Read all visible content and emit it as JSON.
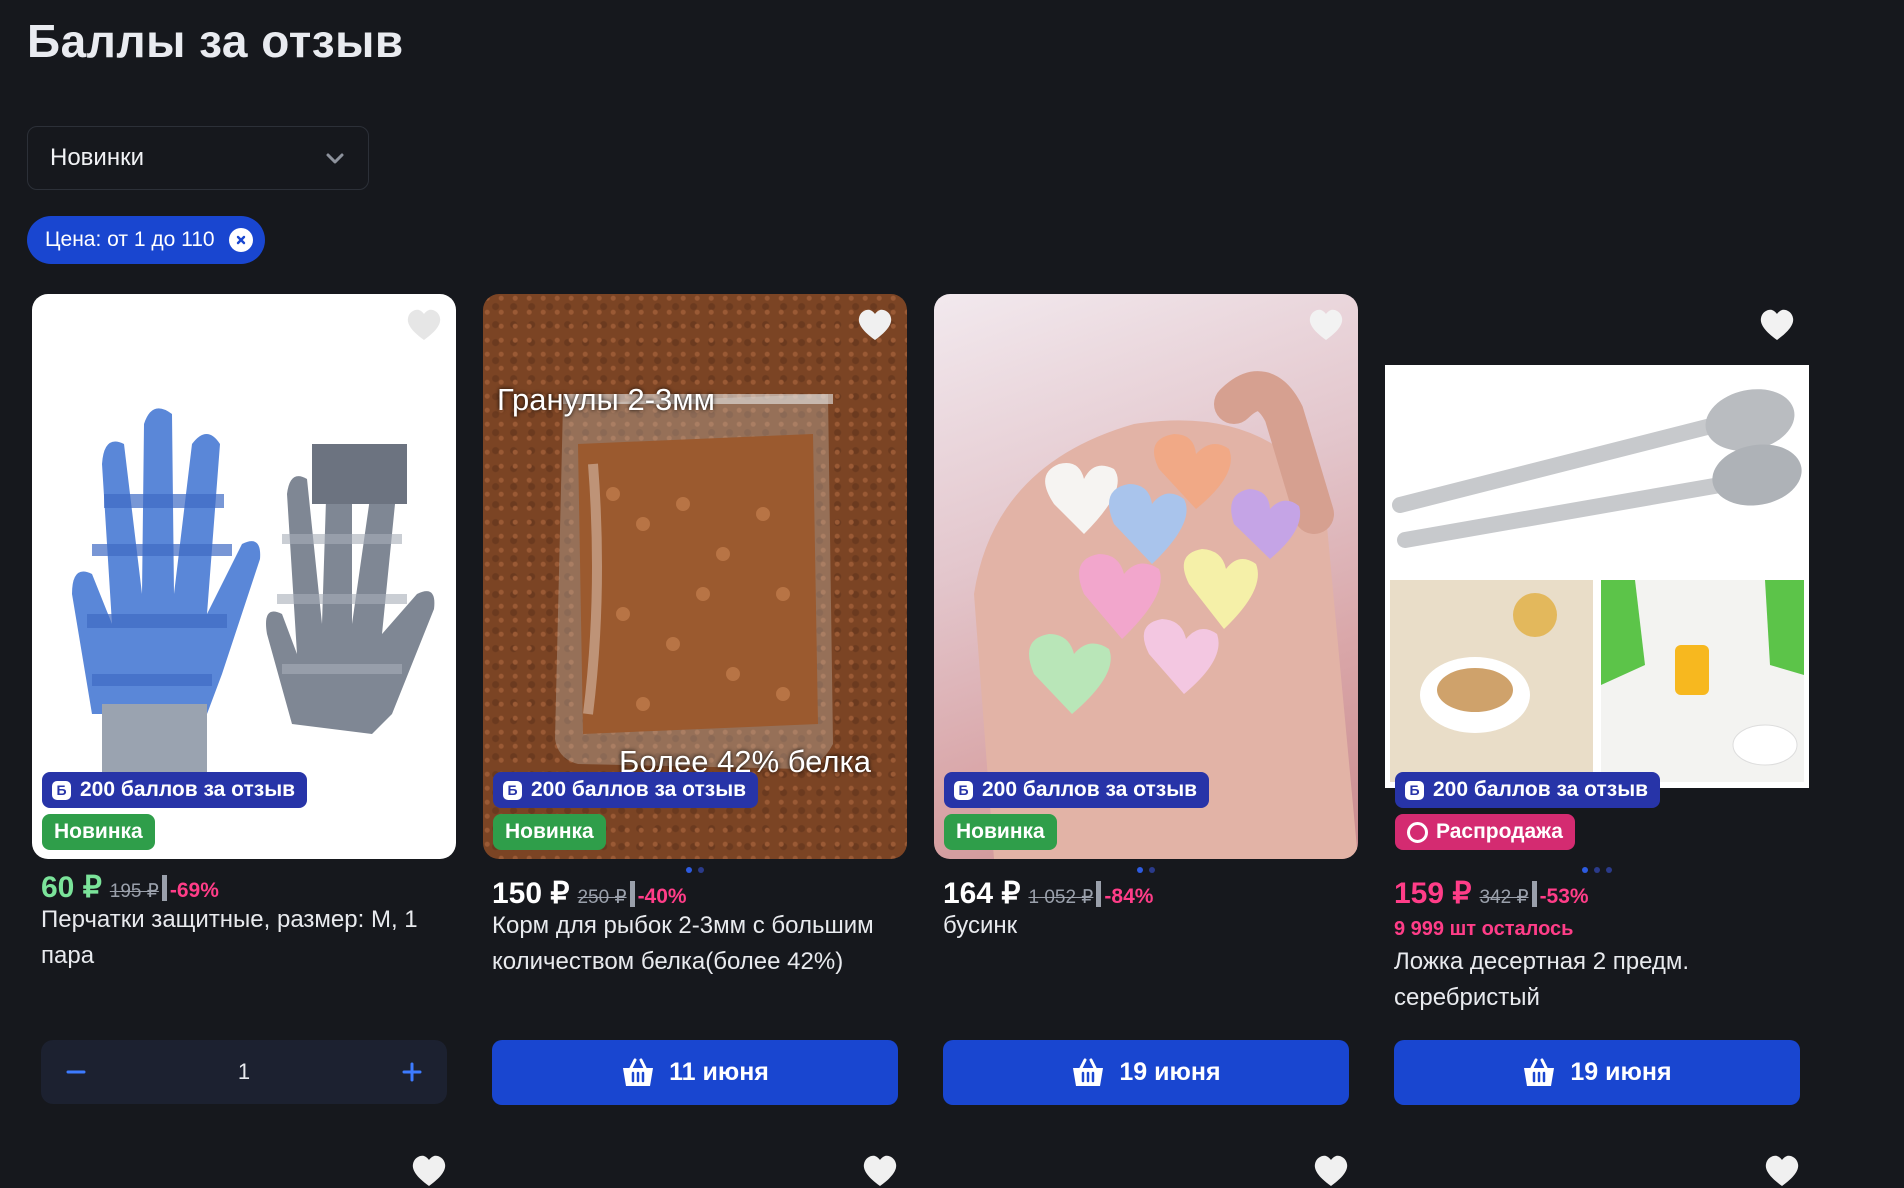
{
  "page": {
    "title": "Баллы за отзыв"
  },
  "sort": {
    "selected": "Новинки"
  },
  "filter_chip": {
    "label": "Цена: от 1 до 110"
  },
  "points_badge_label": "200 баллов за отзыв",
  "points_badge_letter": "Б",
  "colors": {
    "accent": "#1946d0",
    "background": "#16181d",
    "new_badge": "#2f9e4a",
    "sale_badge": "#d42b71",
    "discount": "#ff3d88",
    "price_green": "#7be39a"
  },
  "products": [
    {
      "tag": "Новинка",
      "price": "60 ₽",
      "old_price": "195 ₽",
      "discount": "-69%",
      "name": "Перчатки защитные, размер: M, 1 пара",
      "quantity": "1",
      "image_caption_top": "",
      "image_caption_bottom": ""
    },
    {
      "tag": "Новинка",
      "price": "150 ₽",
      "old_price": "250 ₽",
      "discount": "-40%",
      "name": "Корм для рыбок 2-3мм с большим количеством белка(более 42%)",
      "delivery": "11 июня",
      "image_caption_top": "Гранулы 2-3мм",
      "image_caption_bottom": "Более 42% белка"
    },
    {
      "tag": "Новинка",
      "price": "164 ₽",
      "old_price": "1 052 ₽",
      "discount": "-84%",
      "name": "бусинк",
      "delivery": "19 июня"
    },
    {
      "tag": "Распродажа",
      "price": "159 ₽",
      "old_price": "342 ₽",
      "discount": "-53%",
      "stock": "9 999 шт осталось",
      "name": "Ложка десертная 2 предм. серебристый",
      "delivery": "19 июня"
    }
  ]
}
